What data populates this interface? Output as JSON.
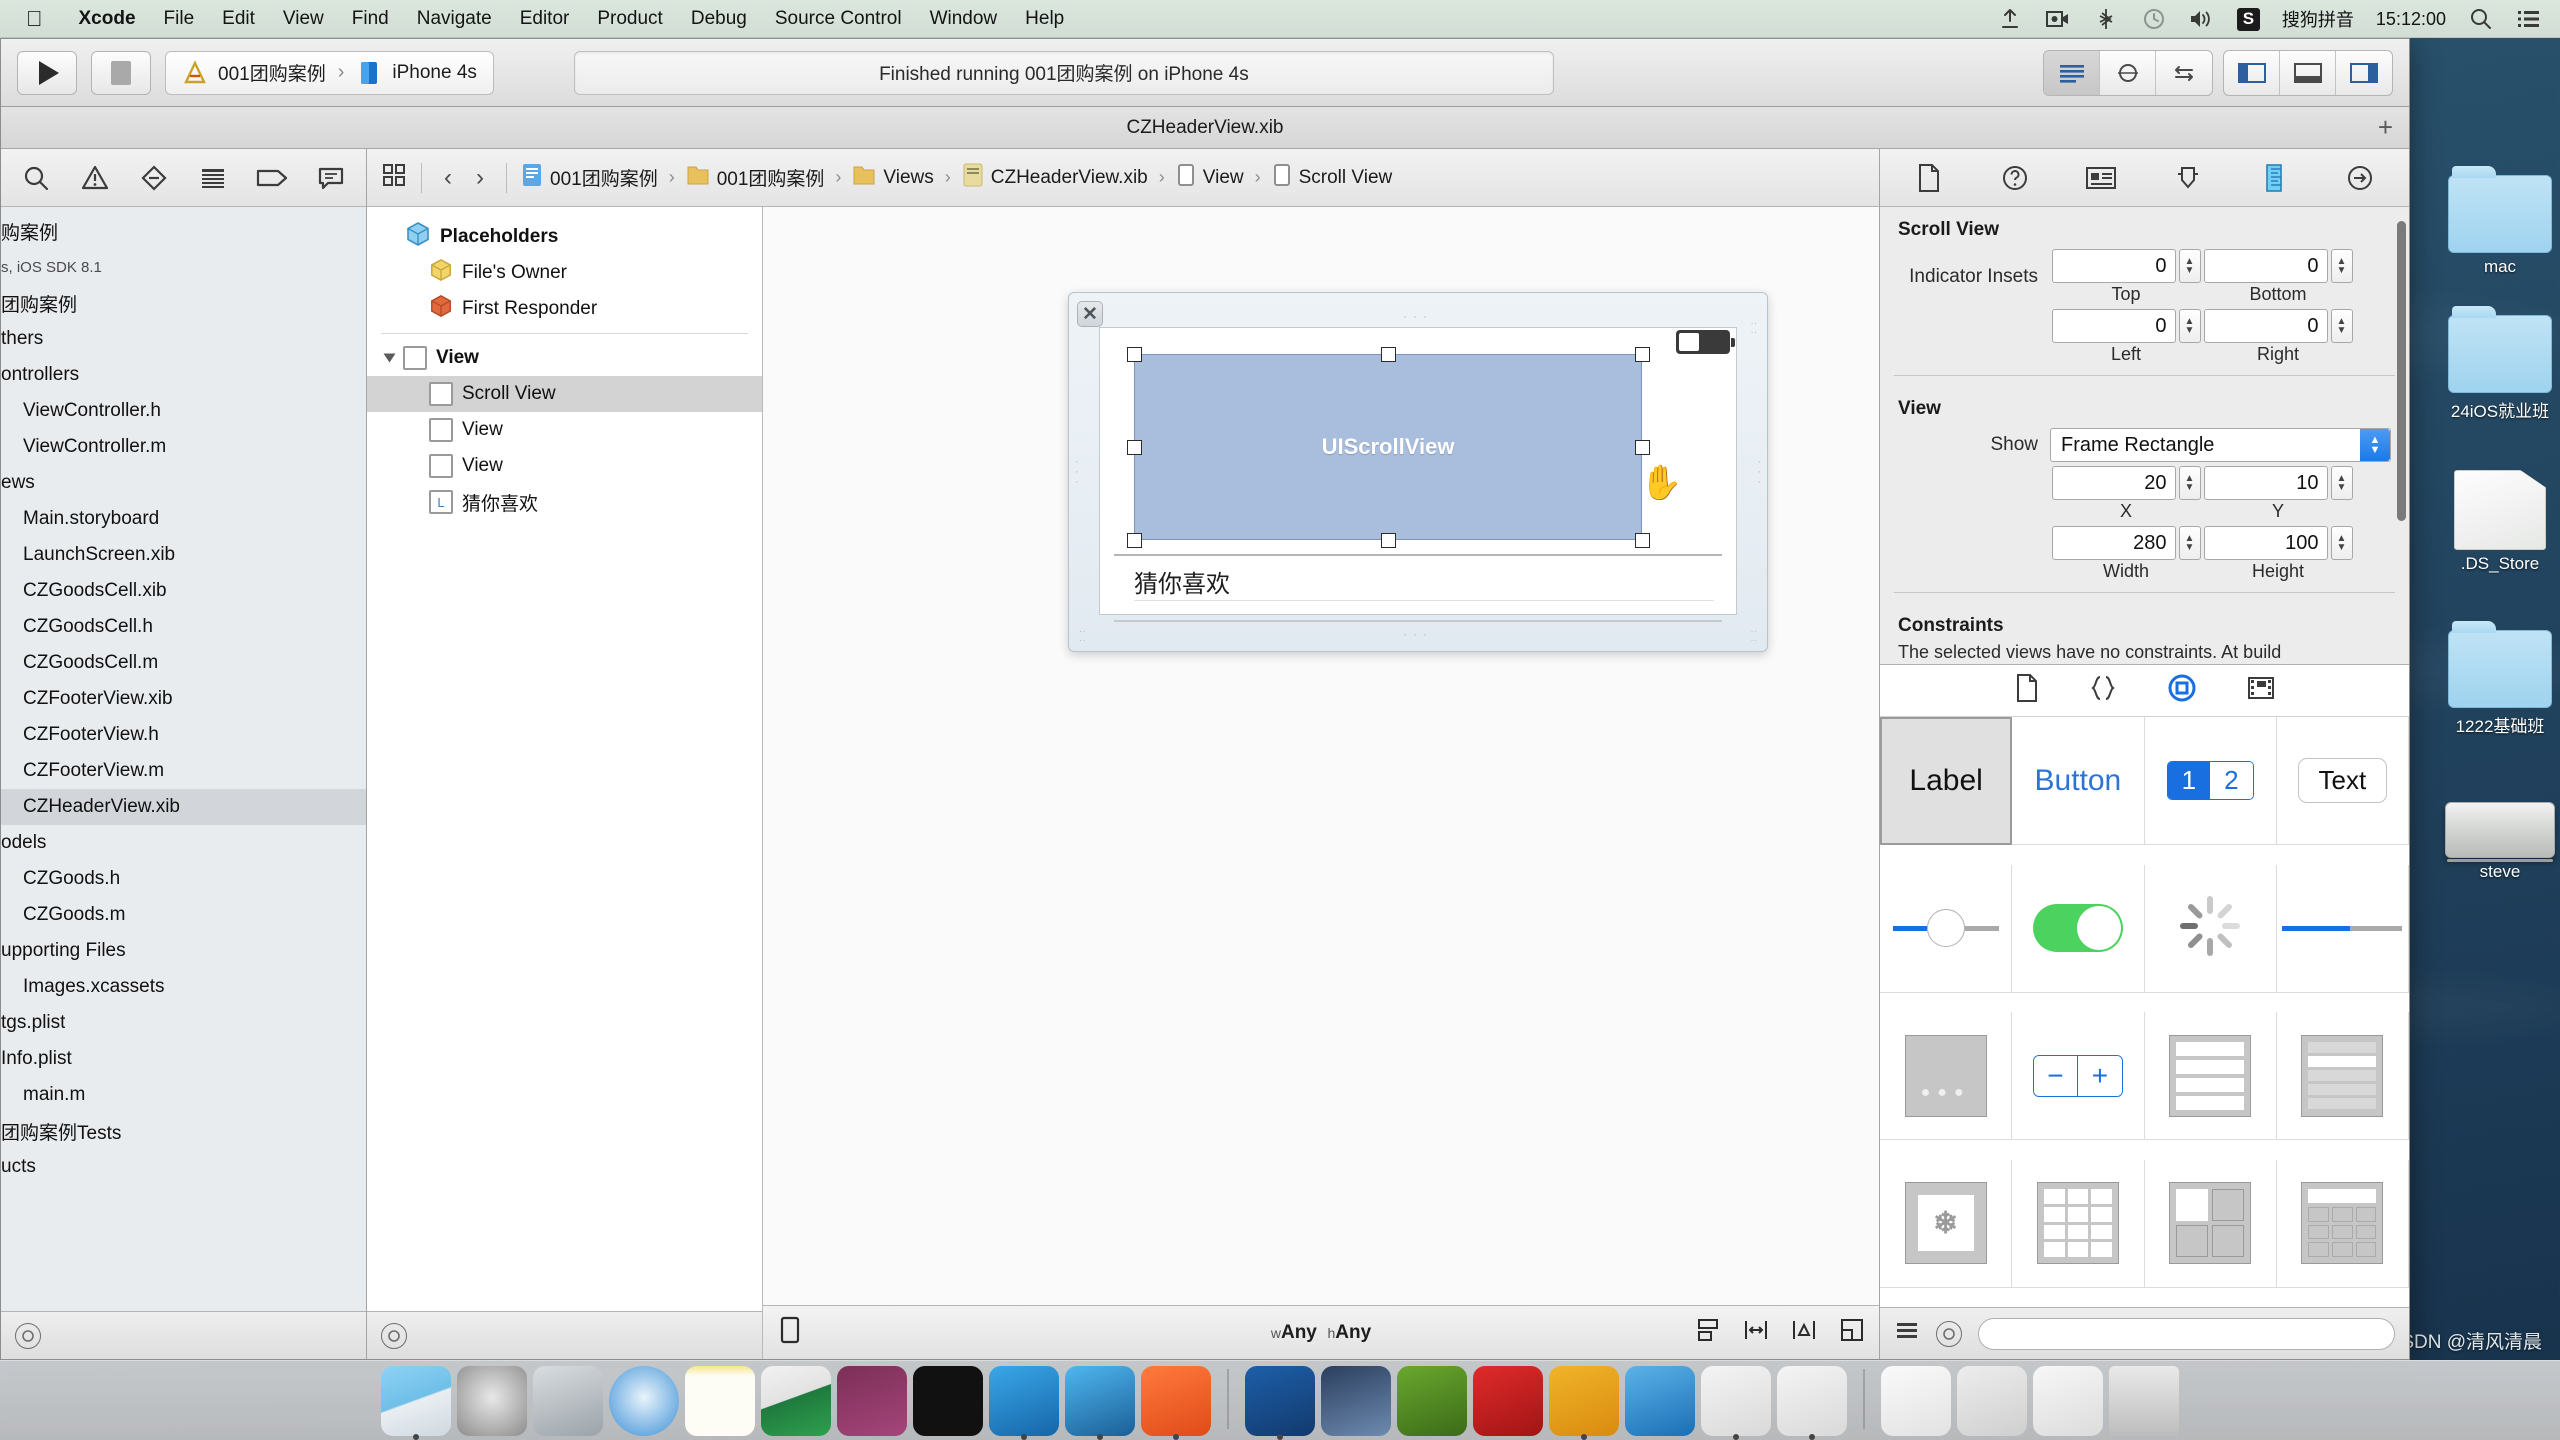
{
  "menubar": {
    "apple_icon": "apple-logo",
    "items": [
      {
        "label": "Xcode",
        "bold": true
      },
      {
        "label": "File",
        "bold": false
      },
      {
        "label": "Edit",
        "bold": false
      },
      {
        "label": "View",
        "bold": false
      },
      {
        "label": "Find",
        "bold": false
      },
      {
        "label": "Navigate",
        "bold": false
      },
      {
        "label": "Editor",
        "bold": false
      },
      {
        "label": "Product",
        "bold": false
      },
      {
        "label": "Debug",
        "bold": false
      },
      {
        "label": "Source Control",
        "bold": false
      },
      {
        "label": "Window",
        "bold": false
      },
      {
        "label": "Help",
        "bold": false
      }
    ],
    "right": {
      "ime_badge": "S",
      "ime_label": "搜狗拼音",
      "clock": "15:12:00",
      "icons": [
        "airdrop-icon",
        "screen-record-icon",
        "bluetooth-icon",
        "time-machine-icon",
        "volume-icon",
        "spotlight-search-icon",
        "notification-center-icon"
      ]
    }
  },
  "desktop": {
    "icons": [
      {
        "name": "mac",
        "type": "folder"
      },
      {
        "name": "24iOS就业班",
        "type": "folder"
      },
      {
        "name": ".DS_Store",
        "type": "doc"
      },
      {
        "name": "1222基础班",
        "type": "folder"
      },
      {
        "name": "steve",
        "type": "disk"
      }
    ],
    "watermark": "CSDN @清风清晨"
  },
  "toolbar": {
    "run_button": "run-button",
    "stop_button": "stop-button",
    "scheme_project": "001团购案例",
    "scheme_device": "iPhone 4s",
    "status": "Finished running 001团购案例 on iPhone 4s",
    "editor_segments": [
      "standard-editor",
      "assistant-editor",
      "version-editor"
    ],
    "view_segments": [
      "toggle-navigator",
      "toggle-debug-area",
      "toggle-utilities"
    ]
  },
  "titlebar": {
    "document": "CZHeaderView.xib",
    "add_tab": "+"
  },
  "navigator": {
    "toolbar_icons": [
      "project-navigator-icon",
      "issue-navigator-icon",
      "test-navigator-icon",
      "debug-navigator-icon",
      "breakpoint-navigator-icon",
      "report-navigator-icon"
    ],
    "items": [
      {
        "label": "购案例",
        "indent": 0,
        "sub": "",
        "selected": false
      },
      {
        "label": "s, iOS SDK 8.1",
        "indent": 0,
        "sub": "small",
        "selected": false
      },
      {
        "label": "团购案例",
        "indent": 0,
        "sub": "",
        "selected": false
      },
      {
        "label": "thers",
        "indent": 0,
        "sub": "",
        "selected": false
      },
      {
        "label": "ontrollers",
        "indent": 0,
        "sub": "",
        "selected": false
      },
      {
        "label": "ViewController.h",
        "indent": 1,
        "sub": "",
        "selected": false
      },
      {
        "label": "ViewController.m",
        "indent": 1,
        "sub": "",
        "selected": false
      },
      {
        "label": "ews",
        "indent": 0,
        "sub": "",
        "selected": false
      },
      {
        "label": "Main.storyboard",
        "indent": 1,
        "sub": "",
        "selected": false
      },
      {
        "label": "LaunchScreen.xib",
        "indent": 1,
        "sub": "",
        "selected": false
      },
      {
        "label": "CZGoodsCell.xib",
        "indent": 1,
        "sub": "",
        "selected": false
      },
      {
        "label": "CZGoodsCell.h",
        "indent": 1,
        "sub": "",
        "selected": false
      },
      {
        "label": "CZGoodsCell.m",
        "indent": 1,
        "sub": "",
        "selected": false
      },
      {
        "label": "CZFooterView.xib",
        "indent": 1,
        "sub": "",
        "selected": false
      },
      {
        "label": "CZFooterView.h",
        "indent": 1,
        "sub": "",
        "selected": false
      },
      {
        "label": "CZFooterView.m",
        "indent": 1,
        "sub": "",
        "selected": false
      },
      {
        "label": "CZHeaderView.xib",
        "indent": 1,
        "sub": "",
        "selected": true
      },
      {
        "label": "odels",
        "indent": 0,
        "sub": "",
        "selected": false
      },
      {
        "label": "CZGoods.h",
        "indent": 1,
        "sub": "",
        "selected": false
      },
      {
        "label": "CZGoods.m",
        "indent": 1,
        "sub": "",
        "selected": false
      },
      {
        "label": "upporting Files",
        "indent": 0,
        "sub": "",
        "selected": false
      },
      {
        "label": "Images.xcassets",
        "indent": 1,
        "sub": "",
        "selected": false
      },
      {
        "label": "tgs.plist",
        "indent": 0,
        "sub": "",
        "selected": false
      },
      {
        "label": "Info.plist",
        "indent": 0,
        "sub": "",
        "selected": false
      },
      {
        "label": "main.m",
        "indent": 1,
        "sub": "",
        "selected": false
      },
      {
        "label": "团购案例Tests",
        "indent": 0,
        "sub": "",
        "selected": false
      },
      {
        "label": "ucts",
        "indent": 0,
        "sub": "",
        "selected": false
      }
    ]
  },
  "breadcrumb": {
    "back_arrow": "‹",
    "forward_arrow": "›",
    "items": [
      {
        "label": "001团购案例",
        "icon": "project-icon"
      },
      {
        "label": "001团购案例",
        "icon": "folder-icon"
      },
      {
        "label": "Views",
        "icon": "folder-icon"
      },
      {
        "label": "CZHeaderView.xib",
        "icon": "xib-icon"
      },
      {
        "label": "View",
        "icon": "view-icon"
      },
      {
        "label": "Scroll View",
        "icon": "view-icon"
      }
    ]
  },
  "outline": {
    "placeholders_title": "Placeholders",
    "items": [
      {
        "label": "File's Owner",
        "icon": "yellow-cube-icon",
        "indent": 1,
        "selected": false
      },
      {
        "label": "First Responder",
        "icon": "red-cube-icon",
        "indent": 1,
        "selected": false
      }
    ],
    "view_root": "View",
    "children": [
      {
        "label": "Scroll View",
        "icon": "view-square-icon",
        "selected": true
      },
      {
        "label": "View",
        "icon": "view-square-icon",
        "selected": false
      },
      {
        "label": "View",
        "icon": "view-square-icon",
        "selected": false
      },
      {
        "label": "猜你喜欢",
        "icon": "label-icon",
        "selected": false
      }
    ]
  },
  "canvas": {
    "scrollview_label": "UIScrollView",
    "label_text": "猜你喜欢",
    "cursor": "open-hand-cursor",
    "bottom_size_class": "wAny hAny",
    "size_class_w": "w",
    "size_class_h": "h"
  },
  "inspector": {
    "tabs": [
      "file-inspector-icon",
      "quick-help-icon",
      "identity-inspector-icon",
      "attributes-inspector-icon",
      "size-inspector-icon",
      "connections-inspector-icon"
    ],
    "active_tab_index": 4,
    "scrollview": {
      "title": "Scroll View",
      "indicator_insets_label": "Indicator Insets",
      "top": {
        "value": "0",
        "label": "Top"
      },
      "bottom": {
        "value": "0",
        "label": "Bottom"
      },
      "left": {
        "value": "0",
        "label": "Left"
      },
      "right": {
        "value": "0",
        "label": "Right"
      }
    },
    "view": {
      "title": "View",
      "show_label": "Show",
      "show_value": "Frame Rectangle",
      "x": {
        "value": "20",
        "label": "X"
      },
      "y": {
        "value": "10",
        "label": "Y"
      },
      "width": {
        "value": "280",
        "label": "Width"
      },
      "height": {
        "value": "100",
        "label": "Height"
      }
    },
    "constraints": {
      "title": "Constraints",
      "text": "The selected views have no constraints. At build"
    }
  },
  "library": {
    "tabs": [
      "file-template-library-icon",
      "code-snippet-library-icon",
      "object-library-icon",
      "media-library-icon"
    ],
    "active_tab_index": 2,
    "objects": [
      {
        "name": "Label",
        "kind": "label",
        "selected": true
      },
      {
        "name": "Button",
        "kind": "button",
        "selected": false
      },
      {
        "name": "1 2",
        "kind": "segmented",
        "selected": false
      },
      {
        "name": "Text",
        "kind": "textfield",
        "selected": false
      },
      {
        "name": "",
        "kind": "slider",
        "selected": false
      },
      {
        "name": "",
        "kind": "switch",
        "selected": false
      },
      {
        "name": "",
        "kind": "activity-indicator",
        "selected": false
      },
      {
        "name": "",
        "kind": "progress-view",
        "selected": false
      },
      {
        "name": "",
        "kind": "page-control",
        "selected": false
      },
      {
        "name": "",
        "kind": "stepper",
        "selected": false
      },
      {
        "name": "",
        "kind": "table-view",
        "selected": false
      },
      {
        "name": "",
        "kind": "table-view-cell",
        "selected": false
      },
      {
        "name": "",
        "kind": "image-view",
        "selected": false
      },
      {
        "name": "",
        "kind": "collection-view",
        "selected": false
      },
      {
        "name": "",
        "kind": "split-view",
        "selected": false
      },
      {
        "name": "",
        "kind": "search-bar",
        "selected": false
      }
    ],
    "segmented_left": "1",
    "segmented_right": "2"
  },
  "dock": {
    "icons": [
      "finder",
      "system-preferences",
      "launchpad",
      "safari",
      "notes",
      "excel",
      "onenote",
      "terminal",
      "xcode",
      "xcode-beta",
      "reeder",
      "acrobat",
      "photos",
      "keynote-alt",
      "filezilla",
      "sketch",
      "word",
      "app-alt-1",
      "app-alt-2"
    ],
    "trash": "trash-icon"
  }
}
